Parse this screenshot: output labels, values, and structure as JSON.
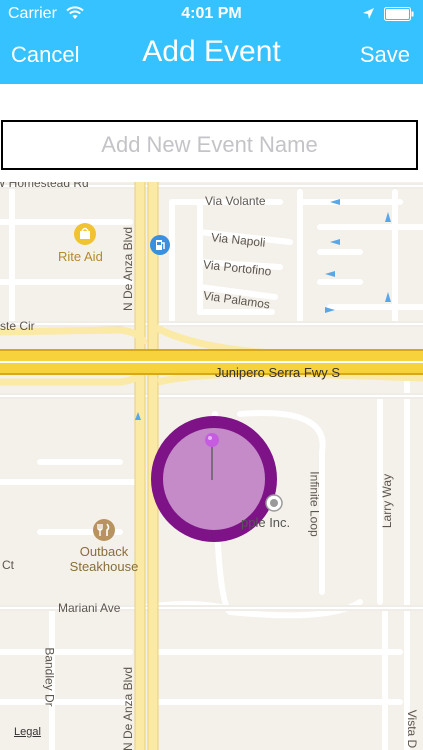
{
  "status_bar": {
    "carrier": "Carrier",
    "time": "4:01 PM"
  },
  "nav": {
    "cancel_label": "Cancel",
    "title": "Add Event",
    "save_label": "Save"
  },
  "event_name": {
    "value": "",
    "placeholder": "Add New Event Name"
  },
  "map": {
    "legal_label": "Legal",
    "pois": {
      "rite_aid": "Rite Aid",
      "outback": "Outback Steakhouse",
      "apple": "pple Inc."
    },
    "streets": {
      "homestead": "W Homestead Rd",
      "via_volante": "Via Volante",
      "via_napoli": "Via Napoli",
      "via_portofino": "Via Portofino",
      "via_palamos": "Via Palamos",
      "ste_cir": "ste Cir",
      "freeway": "Junipero Serra Fwy S",
      "de_anza_top": "N De Anza Blvd",
      "de_anza_bottom": "N De Anza Blvd",
      "infinite_loop": "Infinite Loop",
      "larry_way": "Larry Way",
      "ct": "Ct",
      "mariani": "Mariani Ave",
      "bandley": "Bandley Dr",
      "vista": "Vista D"
    },
    "colors": {
      "header": "#35c2ff",
      "map_bg": "#f4f1eb",
      "freeway": "#f8d23c",
      "geofence_ring": "#7d1387",
      "geofence_fill": "#c48bc8",
      "pin": "#c65de0"
    },
    "icons": [
      "wifi-icon",
      "location-arrow-icon",
      "battery-icon",
      "shopping-bag-icon",
      "fuel-icon",
      "fork-knife-icon",
      "map-pin-icon"
    ]
  }
}
